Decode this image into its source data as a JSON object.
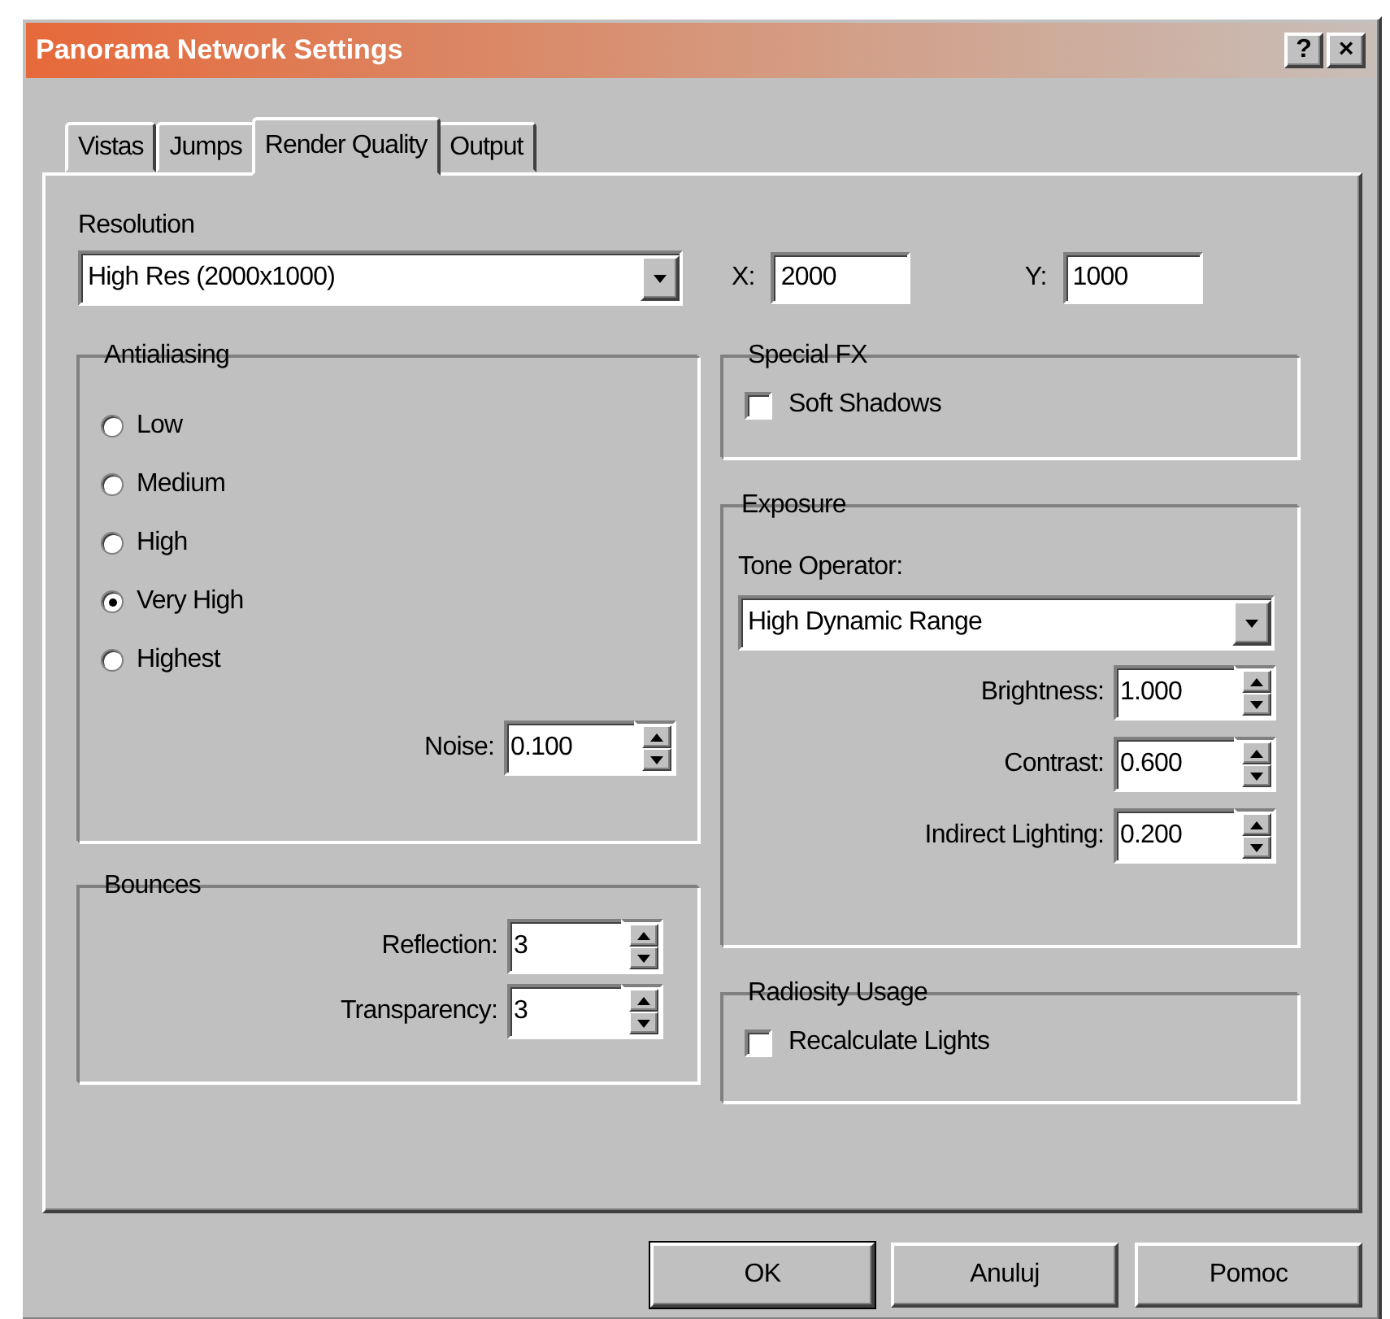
{
  "window": {
    "title": "Panorama Network Settings",
    "help_button": "?",
    "close_button": "×"
  },
  "tabs": [
    {
      "label": "Vistas",
      "selected": false
    },
    {
      "label": "Jumps",
      "selected": false
    },
    {
      "label": "Render Quality",
      "selected": true
    },
    {
      "label": "Output",
      "selected": false
    }
  ],
  "resolution": {
    "label": "Resolution",
    "value": "High Res (2000x1000)",
    "x_label": "X:",
    "x_value": "2000",
    "y_label": "Y:",
    "y_value": "1000"
  },
  "antialiasing": {
    "title": "Antialiasing",
    "options": [
      {
        "label": "Low",
        "selected": false
      },
      {
        "label": "Medium",
        "selected": false
      },
      {
        "label": "High",
        "selected": false
      },
      {
        "label": "Very High",
        "selected": true
      },
      {
        "label": "Highest",
        "selected": false
      }
    ],
    "noise": {
      "label": "Noise:",
      "value": "0.100"
    }
  },
  "bounces": {
    "title": "Bounces",
    "fields": [
      {
        "label": "Reflection:",
        "value": "3"
      },
      {
        "label": "Transparency:",
        "value": "3"
      }
    ]
  },
  "special_fx": {
    "title": "Special FX",
    "checkboxes": [
      {
        "label": "Soft Shadows",
        "checked": false
      }
    ]
  },
  "exposure": {
    "title": "Exposure",
    "tone_label": "Tone Operator:",
    "tone_value": "High Dynamic Range",
    "fields": [
      {
        "label": "Brightness:",
        "value": "1.000"
      },
      {
        "label": "Contrast:",
        "value": "0.600"
      },
      {
        "label": "Indirect Lighting:",
        "value": "0.200"
      }
    ]
  },
  "radiosity": {
    "title": "Radiosity Usage",
    "checkboxes": [
      {
        "label": "Recalculate Lights",
        "checked": false
      }
    ]
  },
  "buttons": [
    {
      "label": "OK",
      "default": true
    },
    {
      "label": "Anuluj",
      "default": false
    },
    {
      "label": "Pomoc",
      "default": false
    }
  ]
}
